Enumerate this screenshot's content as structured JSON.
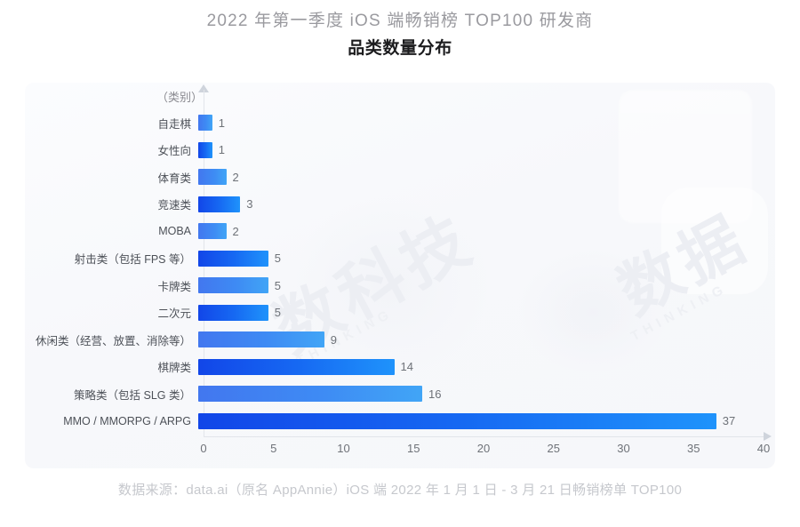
{
  "header": {
    "main_title": "2022 年第一季度 iOS 端畅销榜 TOP100 研发商",
    "sub_title": "品类数量分布"
  },
  "footer": {
    "source_text": "数据来源：data.ai（原名 AppAnnie）iOS 端 2022 年 1 月 1 日 - 3 月 21 日畅销榜单 TOP100"
  },
  "axis": {
    "y_caption": "（类别）"
  },
  "colors": {
    "bar_dark_start": "#1246e8",
    "bar_dark_end": "#1f93fb",
    "bar_light_start": "#4277ef",
    "bar_light_end": "#41a5f6",
    "panel_bg": "#f7f8fb",
    "title_gray": "#9a9a9f",
    "label_gray": "#4d5158",
    "value_gray": "#6e7278"
  },
  "chart_data": {
    "type": "bar",
    "orientation": "horizontal",
    "title": "2022 年第一季度 iOS 端畅销榜 TOP100 研发商 品类数量分布",
    "subtitle": "品类数量分布",
    "xlabel": "",
    "ylabel": "（类别）",
    "xlim": [
      0,
      40
    ],
    "xticks": [
      "0",
      "5",
      "10",
      "15",
      "20",
      "25",
      "30",
      "35",
      "40"
    ],
    "xtick_values": [
      0,
      5,
      10,
      15,
      20,
      25,
      30,
      35,
      40
    ],
    "grid": false,
    "legend": "none",
    "categories": [
      "自走棋",
      "女性向",
      "体育类",
      "竞速类",
      "MOBA",
      "射击类（包括 FPS 等）",
      "卡牌类",
      "二次元",
      "休闲类（经营、放置、消除等）",
      "棋牌类",
      "策略类（包括 SLG 类）",
      "MMO / MMORPG / ARPG"
    ],
    "values": [
      1,
      1,
      2,
      3,
      2,
      5,
      5,
      5,
      9,
      14,
      16,
      37
    ],
    "value_labels": [
      "1",
      "1",
      "2",
      "3",
      "2",
      "5",
      "5",
      "5",
      "9",
      "14",
      "16",
      "37"
    ],
    "bar_styles": [
      "light",
      "dark",
      "light",
      "dark",
      "light",
      "dark",
      "light",
      "dark",
      "light",
      "dark",
      "light",
      "dark"
    ],
    "source": "数据来源：data.ai（原名 AppAnnie）iOS 端 2022 年 1 月 1 日 - 3 月 21 日畅销榜单 TOP100"
  }
}
